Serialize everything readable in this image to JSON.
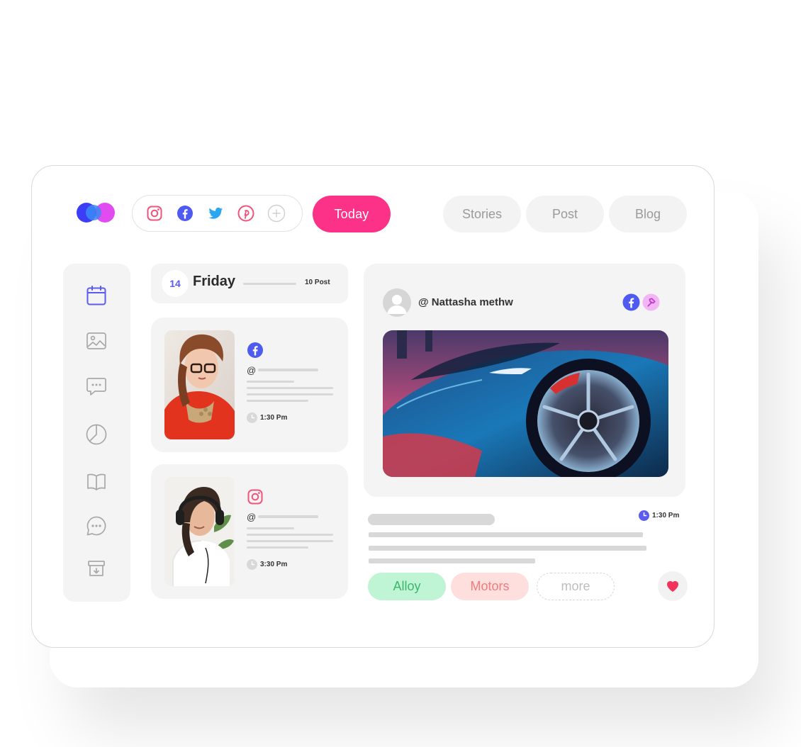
{
  "toolbar": {
    "social_icons": [
      "instagram-icon",
      "facebook-icon",
      "twitter-icon",
      "pinterest-icon",
      "add-icon"
    ],
    "today_label": "Today",
    "tabs": [
      {
        "label": "Stories"
      },
      {
        "label": "Post"
      },
      {
        "label": "Blog"
      }
    ]
  },
  "sidebar": {
    "items": [
      "calendar-icon",
      "image-icon",
      "chat-icon",
      "pie-chart-icon",
      "book-icon",
      "message-icon",
      "archive-icon"
    ]
  },
  "schedule": {
    "date_number": "14",
    "day": "Friday",
    "post_count": "10 Post",
    "posts": [
      {
        "network": "facebook-icon",
        "handle_prefix": "@",
        "time": "1:30 Pm"
      },
      {
        "network": "instagram-icon",
        "handle_prefix": "@",
        "time": "3:30 Pm"
      }
    ]
  },
  "preview": {
    "author": "@ Nattasha methw",
    "networks": [
      "facebook-icon",
      "pin-icon"
    ],
    "time": "1:30 Pm",
    "tags": [
      "Alloy",
      "Motors",
      "more"
    ]
  },
  "colors": {
    "accent": "#fb3288",
    "brand_blue": "#5b5bf0",
    "facebook": "#4f5bf0",
    "instagram": "#f0547a",
    "twitter": "#2aa7f0",
    "tag_alloy_bg": "#bff5d4",
    "tag_motors_bg": "#ffdede"
  }
}
